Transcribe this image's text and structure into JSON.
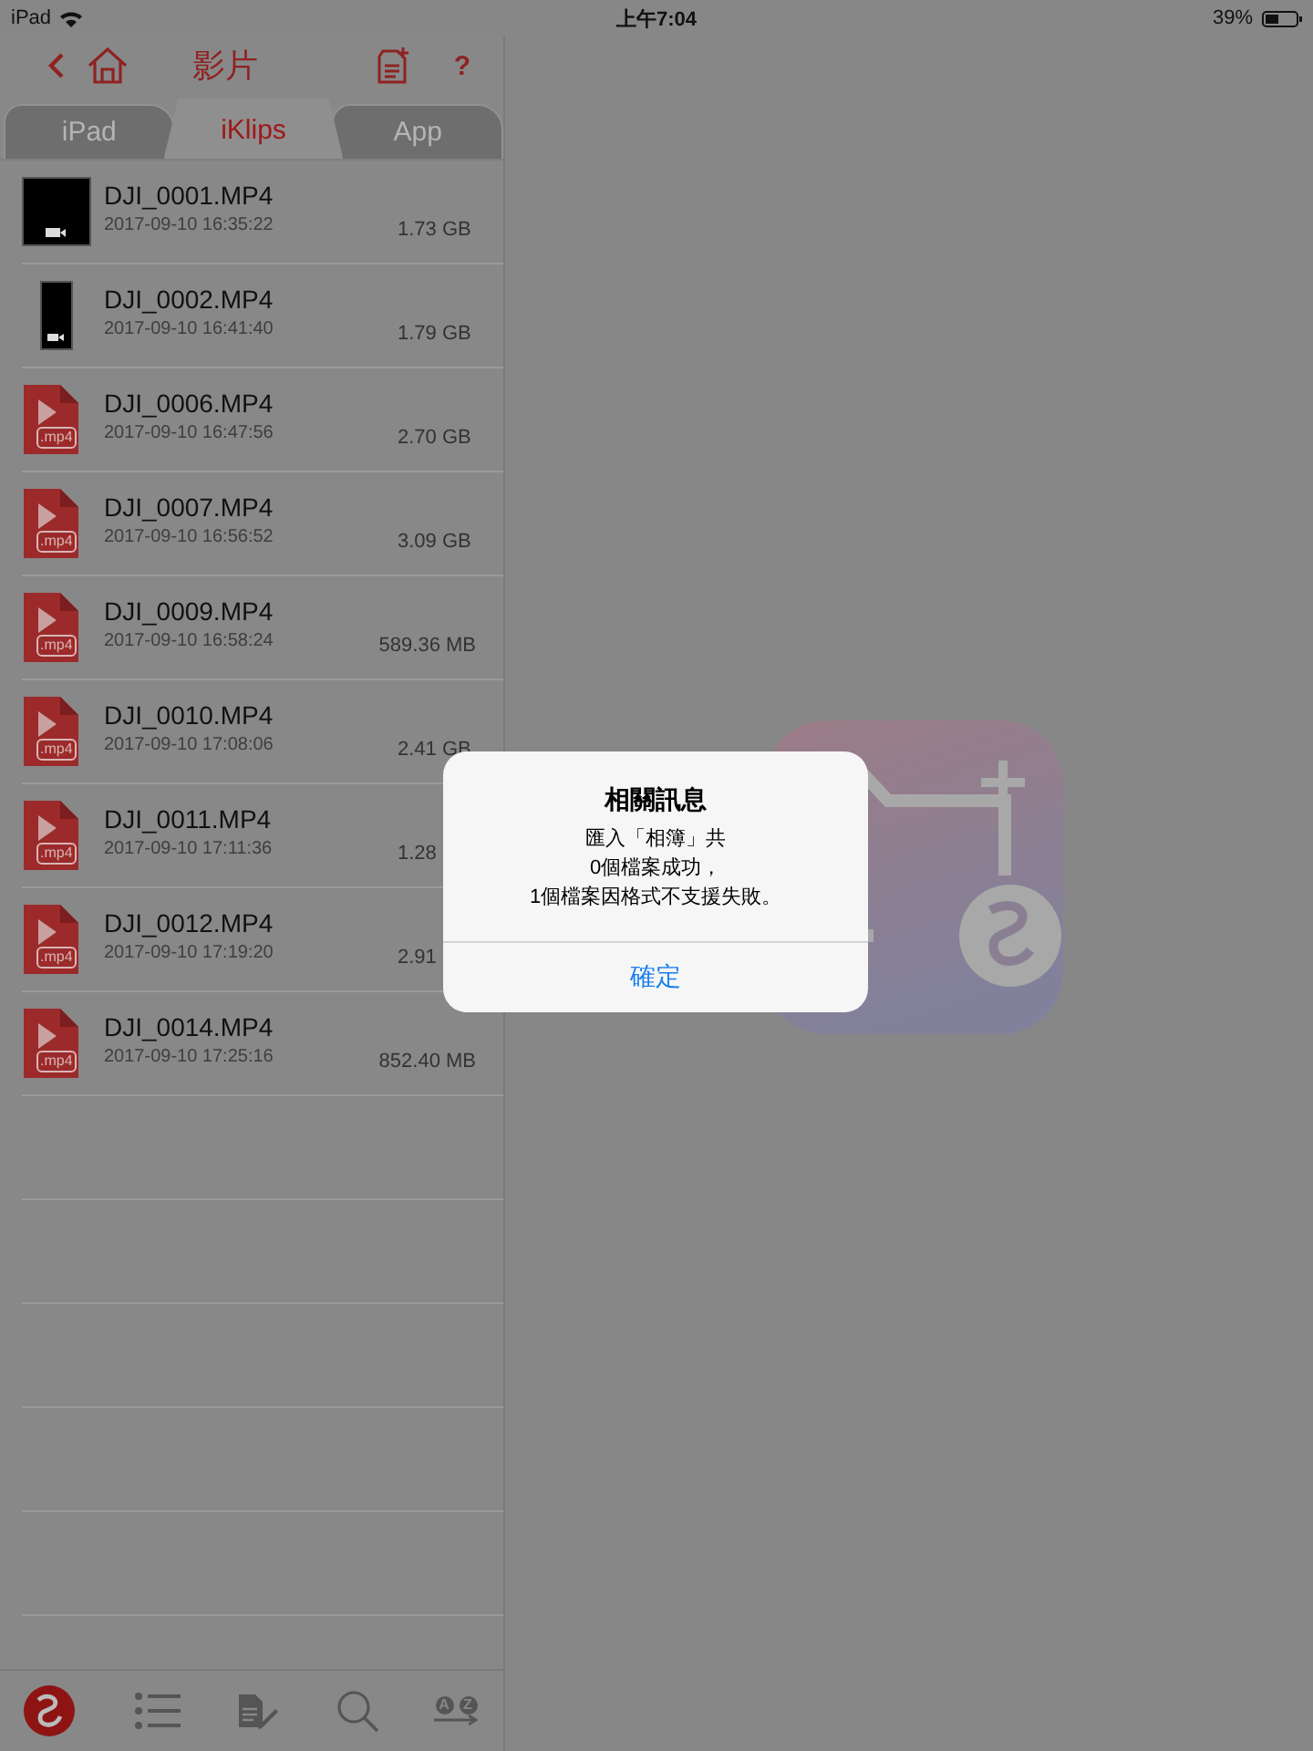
{
  "status_bar": {
    "device": "iPad",
    "time": "上午7:04",
    "battery": "39%"
  },
  "header": {
    "title": "影片",
    "help": "?"
  },
  "tabs": [
    {
      "label": "iPad",
      "selected": false
    },
    {
      "label": "iKlips",
      "selected": true
    },
    {
      "label": "App",
      "selected": false
    }
  ],
  "files": [
    {
      "kind": "video-landscape",
      "name": "DJI_0001.MP4",
      "date": "2017-09-10 16:35:22",
      "size": "1.73 GB"
    },
    {
      "kind": "video-portrait",
      "name": "DJI_0002.MP4",
      "date": "2017-09-10 16:41:40",
      "size": "1.79 GB"
    },
    {
      "kind": "mp4",
      "name": "DJI_0006.MP4",
      "date": "2017-09-10 16:47:56",
      "size": "2.70 GB",
      "badge": ".mp4"
    },
    {
      "kind": "mp4",
      "name": "DJI_0007.MP4",
      "date": "2017-09-10 16:56:52",
      "size": "3.09 GB",
      "badge": ".mp4"
    },
    {
      "kind": "mp4",
      "name": "DJI_0009.MP4",
      "date": "2017-09-10 16:58:24",
      "size": "589.36 MB",
      "badge": ".mp4"
    },
    {
      "kind": "mp4",
      "name": "DJI_0010.MP4",
      "date": "2017-09-10 17:08:06",
      "size": "2.41 GB",
      "badge": ".mp4"
    },
    {
      "kind": "mp4",
      "name": "DJI_0011.MP4",
      "date": "2017-09-10 17:11:36",
      "size": "1.28",
      "badge": ".mp4"
    },
    {
      "kind": "mp4",
      "name": "DJI_0012.MP4",
      "date": "2017-09-10 17:19:20",
      "size": "2.91",
      "badge": ".mp4"
    },
    {
      "kind": "mp4",
      "name": "DJI_0014.MP4",
      "date": "2017-09-10 17:25:16",
      "size": "852.40 MB",
      "badge": ".mp4"
    }
  ],
  "toolbar": [
    {
      "kind": "logo"
    },
    {
      "kind": "list"
    },
    {
      "kind": "edit"
    },
    {
      "kind": "search"
    },
    {
      "kind": "sort",
      "letters": [
        "A",
        "Z"
      ]
    }
  ],
  "dialog": {
    "title": "相關訊息",
    "message": [
      "匯入「相簿」共",
      "0個檔案成功，",
      "1個檔案因格式不支援失敗。"
    ],
    "button": "確定"
  }
}
